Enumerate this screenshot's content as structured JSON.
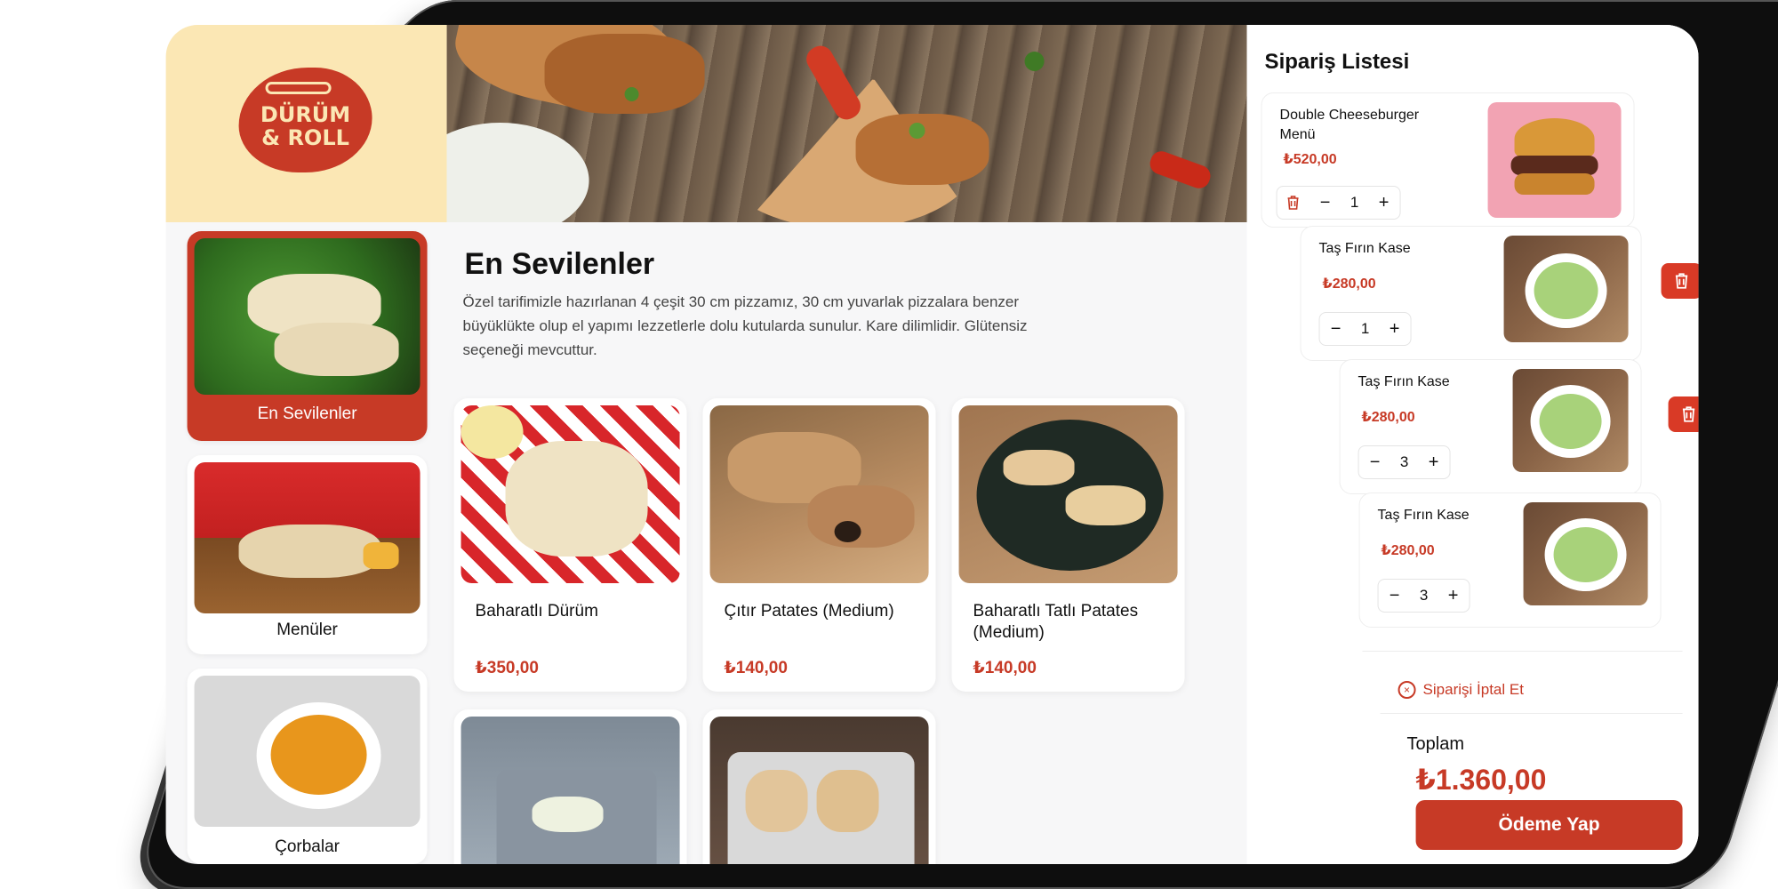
{
  "brand": {
    "logo_line1": "DÜRÜM",
    "logo_line2": "& ROLL",
    "accent_color": "#c73a26",
    "cream_color": "#fbe7b4"
  },
  "categories": [
    {
      "label": "En Sevilenler",
      "active": true
    },
    {
      "label": "Menüler",
      "active": false
    },
    {
      "label": "Çorbalar",
      "active": false
    }
  ],
  "main": {
    "title": "En Sevilenler",
    "description": "Özel tarifimizle hazırlanan 4 çeşit 30 cm pizzamız, 30 cm yuvarlak pizzalara benzer büyüklükte olup el yapımı lezzetlerle dolu kutularda sunulur. Kare dilimlidir. Glütensiz seçeneği mevcuttur.",
    "products": [
      {
        "name": "Baharatlı Dürüm",
        "price": "₺350,00"
      },
      {
        "name": "Çıtır Patates (Medium)",
        "price": "₺140,00"
      },
      {
        "name": "Baharatlı Tatlı Patates (Medium)",
        "price": "₺140,00"
      }
    ]
  },
  "order": {
    "title": "Sipariş Listesi",
    "items": [
      {
        "name": "Double Cheeseburger Menü",
        "price": "₺520,00",
        "qty": "1"
      },
      {
        "name": "Taş Fırın Kase",
        "price": "₺280,00",
        "qty": "1"
      },
      {
        "name": "Taş Fırın Kase",
        "price": "₺280,00",
        "qty": "3"
      },
      {
        "name": "Taş Fırın Kase",
        "price": "₺280,00",
        "qty": "3"
      }
    ],
    "cancel_label": "Siparişi İptal Et",
    "total_label": "Toplam",
    "total_value": "₺1.360,00",
    "pay_label": "Ödeme Yap"
  },
  "icons": {
    "minus": "−",
    "plus": "+",
    "close": "×"
  }
}
